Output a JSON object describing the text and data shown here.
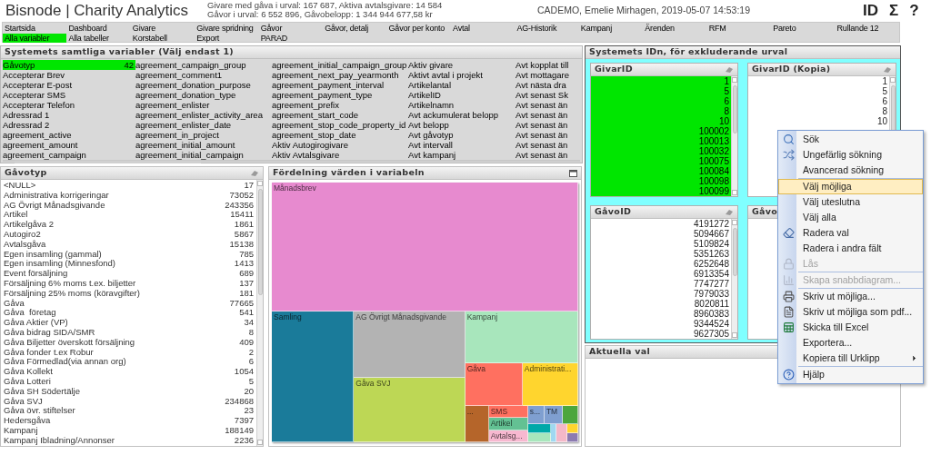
{
  "header": {
    "title": "Bisnode | Charity Analytics",
    "stats": [
      "Givare med gåva i urval: 167 687, Aktiva avtalsgivare: 14 584",
      "Gåvor i urval: 6 552 896, Gåvobelopp: 1 344 944 677,58 kr"
    ],
    "user": "CADEMO, Emelie Mirhagen, 2019-05-07 14:53:19",
    "buttons": [
      "ID",
      "Σ",
      "?"
    ]
  },
  "nav": {
    "rows": [
      [
        {
          "label": "Startsida",
          "selected": false
        },
        {
          "label": "Dashboard",
          "selected": false
        },
        {
          "label": "Givare",
          "selected": false
        },
        {
          "label": "Givare spridning",
          "selected": false
        },
        {
          "label": "Gåvor",
          "selected": false
        },
        {
          "label": "Gåvor, detalj",
          "selected": false
        },
        {
          "label": "Gåvor per konto",
          "selected": false
        },
        {
          "label": "Avtal",
          "selected": false
        },
        {
          "label": "AG-Historik",
          "selected": false
        },
        {
          "label": "Kampanj",
          "selected": false
        },
        {
          "label": "Ärenden",
          "selected": false
        },
        {
          "label": "RFM",
          "selected": false
        },
        {
          "label": "Pareto",
          "selected": false
        },
        {
          "label": "Rullande 12",
          "selected": false
        }
      ],
      [
        {
          "label": "Alla variabler",
          "selected": true
        },
        {
          "label": "Alla tabeller",
          "selected": false
        },
        {
          "label": "Korstabell",
          "selected": false
        },
        {
          "label": "Export",
          "selected": false
        },
        {
          "label": "PARAD",
          "selected": false
        }
      ]
    ]
  },
  "variables": {
    "title": "Systemets samtliga variabler (Välj endast 1)",
    "columns": [
      [
        {
          "label": "Gåvotyp",
          "count": "42",
          "selected": true
        },
        {
          "label": "Accepterar Brev",
          "selected": false
        },
        {
          "label": "Accepterar E-post",
          "selected": false
        },
        {
          "label": "Accepterar SMS",
          "selected": false
        },
        {
          "label": "Accepterar Telefon",
          "selected": false
        },
        {
          "label": "Adressrad 1",
          "selected": false
        },
        {
          "label": "Adressrad 2",
          "selected": false
        },
        {
          "label": "agreement_active",
          "selected": false
        },
        {
          "label": "agreement_amount",
          "selected": false
        },
        {
          "label": "agreement_campaign",
          "selected": false
        }
      ],
      [
        {
          "label": "agreement_campaign_group",
          "selected": false
        },
        {
          "label": "agreement_comment1",
          "selected": false
        },
        {
          "label": "agreement_donation_purpose",
          "selected": false
        },
        {
          "label": "agreement_donation_type",
          "selected": false
        },
        {
          "label": "agreement_enlister",
          "selected": false
        },
        {
          "label": "agreement_enlister_activity_area",
          "selected": false
        },
        {
          "label": "agreement_enlister_date",
          "selected": false
        },
        {
          "label": "agreement_in_project",
          "selected": false
        },
        {
          "label": "agreement_initial_amount",
          "selected": false
        },
        {
          "label": "agreement_initial_campaign",
          "selected": false
        }
      ],
      [
        {
          "label": "agreement_initial_campaign_group",
          "selected": false
        },
        {
          "label": "agreement_next_pay_yearmonth",
          "selected": false
        },
        {
          "label": "agreement_payment_interval",
          "selected": false
        },
        {
          "label": "agreement_payment_type",
          "selected": false
        },
        {
          "label": "agreement_prefix",
          "selected": false
        },
        {
          "label": "agreement_start_code",
          "selected": false
        },
        {
          "label": "agreement_stop_code_property_id",
          "selected": false
        },
        {
          "label": "agreement_stop_date",
          "selected": false
        },
        {
          "label": "Aktiv Autogirogivare",
          "selected": false
        },
        {
          "label": "Aktiv Avtalsgivare",
          "selected": false
        }
      ],
      [
        {
          "label": "Aktiv givare",
          "selected": false
        },
        {
          "label": "Aktivt avtal i projekt",
          "selected": false
        },
        {
          "label": "Artikelantal",
          "selected": false
        },
        {
          "label": "ArtikelID",
          "selected": false
        },
        {
          "label": "Artikelnamn",
          "selected": false
        },
        {
          "label": "Avt ackumulerat belopp",
          "selected": false
        },
        {
          "label": "Avt belopp",
          "selected": false
        },
        {
          "label": "Avt gåvotyp",
          "selected": false
        },
        {
          "label": "Avt intervall",
          "selected": false
        },
        {
          "label": "Avt kampanj",
          "selected": false
        }
      ],
      [
        {
          "label": "Avt kopplat till",
          "selected": false
        },
        {
          "label": "Avt mottagare",
          "selected": false
        },
        {
          "label": "Avt nästa dra",
          "selected": false
        },
        {
          "label": "Avt senast Sk",
          "selected": false
        },
        {
          "label": "Avt senast än",
          "selected": false
        },
        {
          "label": "Avt senast än",
          "selected": false
        },
        {
          "label": "Avt senast än",
          "selected": false
        },
        {
          "label": "Avt senast än",
          "selected": false
        },
        {
          "label": "Avt senast än",
          "selected": false
        },
        {
          "label": "Avt senast än",
          "selected": false
        }
      ]
    ]
  },
  "gavotyp": {
    "title": "Gåvotyp",
    "rows": [
      {
        "label": "<NULL>",
        "count": "17"
      },
      {
        "label": "Administrativa korrigeringar",
        "count": "73052"
      },
      {
        "label": "AG Övrigt Månadsgivande",
        "count": "243356"
      },
      {
        "label": "Artikel",
        "count": "15411"
      },
      {
        "label": "Artikelgåva 2",
        "count": "1861"
      },
      {
        "label": "Autogiro2",
        "count": "5867"
      },
      {
        "label": "Avtalsgåva",
        "count": "15138"
      },
      {
        "label": "Egen insamling (gammal)",
        "count": "785"
      },
      {
        "label": "Egen insamling (Minnesfond)",
        "count": "1413"
      },
      {
        "label": "Event försäljning",
        "count": "689"
      },
      {
        "label": "Försäljning 6% moms t.ex. biljetter",
        "count": "137"
      },
      {
        "label": "Försäljning 25% moms (köravgifter)",
        "count": "181"
      },
      {
        "label": "Gåva",
        "count": "77665"
      },
      {
        "label": "Gåva  företag",
        "count": "541"
      },
      {
        "label": "Gåva Aktier (VP)",
        "count": "34"
      },
      {
        "label": "Gåva bidrag SIDA/SMR",
        "count": "8"
      },
      {
        "label": "Gåva Biljetter överskott försäljning",
        "count": "409"
      },
      {
        "label": "Gåva fonder t.ex Robur",
        "count": "2"
      },
      {
        "label": "Gåva Förmedlad(via annan org)",
        "count": "6"
      },
      {
        "label": "Gåva Kollekt",
        "count": "1054"
      },
      {
        "label": "Gåva Lotteri",
        "count": "5"
      },
      {
        "label": "Gåva SH Södertälje",
        "count": "20"
      },
      {
        "label": "Gåva SVJ",
        "count": "234868"
      },
      {
        "label": "Gåva övr. stiftelser",
        "count": "23"
      },
      {
        "label": "Hedersgåva",
        "count": "7397"
      },
      {
        "label": "Kampanj",
        "count": "188149"
      },
      {
        "label": "Kampanj Ibladning/Annonser",
        "count": "2236"
      }
    ]
  },
  "distribution": {
    "title": "Fördelning värden i variabeln",
    "tiles": [
      {
        "label": "Månadsbrev",
        "color": "#e78acf"
      },
      {
        "label": "Samling",
        "color": "#1a7b9a"
      },
      {
        "label": "AG Övrigt Månadsgivande",
        "color": "#b3b3b3"
      },
      {
        "label": "Gåva SVJ",
        "color": "#bdd755"
      },
      {
        "label": "Kampanj",
        "color": "#a8e6bc"
      },
      {
        "label": "Gåva",
        "color": "#ff7060"
      },
      {
        "label": "Administrati...",
        "color": "#ffd52e"
      },
      {
        "label": "...",
        "color": "#b5652a"
      },
      {
        "label": "SMS",
        "color": "#ff7060"
      },
      {
        "label": "Artikel",
        "color": "#63c193"
      },
      {
        "label": "Avtalsg...",
        "color": "#f7b8d0"
      },
      {
        "label": "s...",
        "color": "#7f9fd0"
      },
      {
        "label": "TM",
        "color": "#7f9fd0"
      },
      {
        "color": "#4ca63d"
      },
      {
        "color": "#00a8a8"
      },
      {
        "color": "#a8e6bc"
      },
      {
        "color": "#a0d8f0"
      },
      {
        "color": "#f4b8c8"
      },
      {
        "color": "#ffd52e"
      },
      {
        "color": "#8c7bb0"
      }
    ]
  },
  "ids": {
    "title": "Systemets IDn, för exkluderande urval",
    "boxes": [
      {
        "title": "GivarID",
        "values": [
          {
            "value": "1",
            "selected": true
          },
          {
            "value": "5",
            "selected": true
          },
          {
            "value": "6",
            "selected": true
          },
          {
            "value": "8",
            "selected": true
          },
          {
            "value": "10",
            "selected": true
          },
          {
            "value": "100002",
            "selected": true
          },
          {
            "value": "100013",
            "selected": true
          },
          {
            "value": "100032",
            "selected": true
          },
          {
            "value": "100075",
            "selected": true
          },
          {
            "value": "100084",
            "selected": true
          },
          {
            "value": "100098",
            "selected": true
          },
          {
            "value": "100099",
            "selected": true
          }
        ]
      },
      {
        "title": "GivarID (Kopia)",
        "values": [
          {
            "value": "1",
            "selected": false
          },
          {
            "value": "5",
            "selected": false
          },
          {
            "value": "6",
            "selected": false
          },
          {
            "value": "8",
            "selected": false
          },
          {
            "value": "10",
            "selected": false
          }
        ]
      },
      {
        "title": "GåvoID",
        "values": [
          {
            "value": "4191272",
            "selected": false
          },
          {
            "value": "5094667",
            "selected": false
          },
          {
            "value": "5109824",
            "selected": false
          },
          {
            "value": "5351263",
            "selected": false
          },
          {
            "value": "6252648",
            "selected": false
          },
          {
            "value": "6913354",
            "selected": false
          },
          {
            "value": "7747277",
            "selected": false
          },
          {
            "value": "7979033",
            "selected": false
          },
          {
            "value": "8020811",
            "selected": false
          },
          {
            "value": "8960383",
            "selected": false
          },
          {
            "value": "9344524",
            "selected": false
          },
          {
            "value": "9627305",
            "selected": false
          }
        ]
      },
      {
        "title": "Gåvo"
      }
    ]
  },
  "current": {
    "title": "Aktuella val"
  },
  "context_menu": {
    "groups": [
      [
        {
          "label": "Sök",
          "disabled": false,
          "selected": false,
          "submenu": false
        },
        {
          "label": "Ungefärlig sökning",
          "disabled": false,
          "selected": false,
          "submenu": false
        },
        {
          "label": "Avancerad sökning",
          "disabled": false,
          "selected": false,
          "submenu": false
        }
      ],
      [
        {
          "label": "Välj möjliga",
          "disabled": false,
          "selected": true,
          "submenu": false
        },
        {
          "label": "Välj uteslutna",
          "disabled": false,
          "selected": false,
          "submenu": false
        },
        {
          "label": "Välj alla",
          "disabled": false,
          "selected": false,
          "submenu": false
        },
        {
          "label": "Radera val",
          "disabled": false,
          "selected": false,
          "submenu": false
        },
        {
          "label": "Radera i andra fält",
          "disabled": false,
          "selected": false,
          "submenu": false
        },
        {
          "label": "Lås",
          "disabled": true,
          "selected": false,
          "submenu": false
        }
      ],
      [
        {
          "label": "Skapa snabbdiagram...",
          "disabled": true,
          "selected": false,
          "submenu": false
        }
      ],
      [
        {
          "label": "Skriv ut möjliga...",
          "disabled": false,
          "selected": false,
          "submenu": false
        },
        {
          "label": "Skriv ut möjliga som pdf...",
          "disabled": false,
          "selected": false,
          "submenu": false
        },
        {
          "label": "Skicka till Excel",
          "disabled": false,
          "selected": false,
          "submenu": false
        },
        {
          "label": "Exportera...",
          "disabled": false,
          "selected": false,
          "submenu": false
        },
        {
          "label": "Kopiera till Urklipp",
          "disabled": false,
          "selected": false,
          "submenu": true
        }
      ],
      [
        {
          "label": "Hjälp",
          "disabled": false,
          "selected": false,
          "submenu": false
        }
      ]
    ]
  }
}
